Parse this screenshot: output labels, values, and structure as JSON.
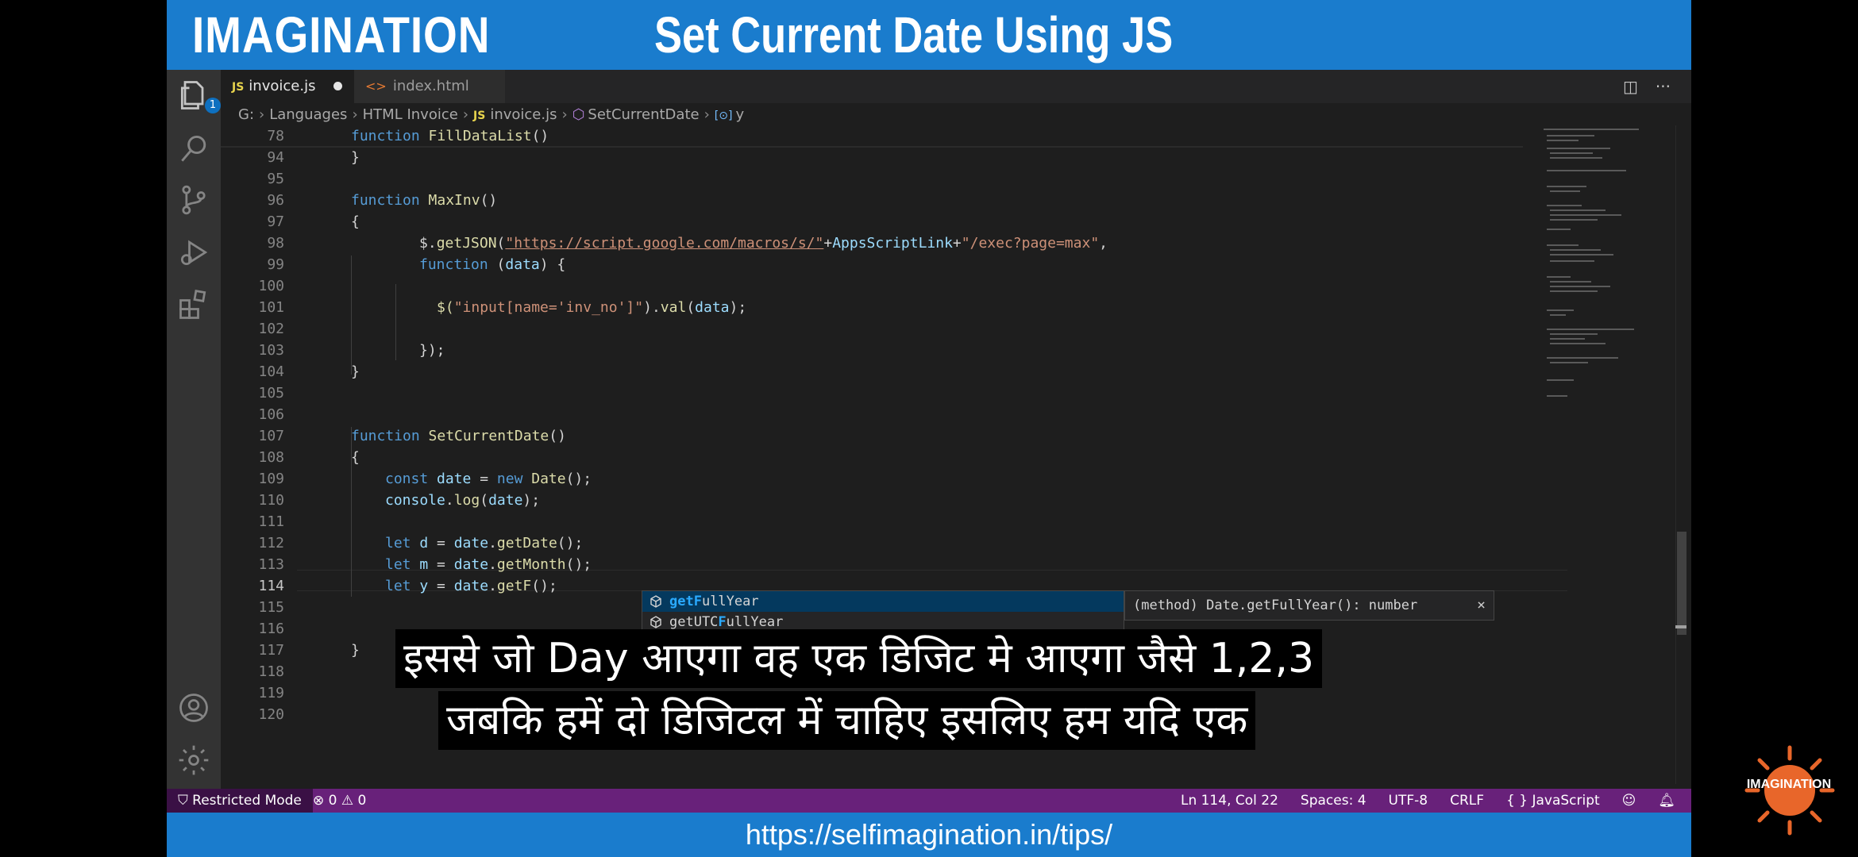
{
  "banner": {
    "brand": "IMAGINATION",
    "title": "Set Current Date Using JS"
  },
  "activity_bar": {
    "explorer_badge": "1"
  },
  "tabs": [
    {
      "lang": "JS",
      "label": "invoice.js"
    },
    {
      "lang": "<>",
      "label": "index.html"
    }
  ],
  "tab_actions": {
    "split": "◫",
    "more": "···"
  },
  "breadcrumb": [
    "G:",
    "Languages",
    "HTML Invoice",
    "invoice.js",
    "SetCurrentDate",
    "y"
  ],
  "breadcrumb_tags": {
    "js": "JS",
    "var": "[⊙]"
  },
  "editor": {
    "line_numbers": [
      "78",
      "94",
      "95",
      "96",
      "97",
      "98",
      "99",
      "100",
      "101",
      "102",
      "103",
      "104",
      "105",
      "106",
      "107",
      "108",
      "109",
      "110",
      "111",
      "112",
      "113",
      "114",
      "115",
      "116",
      "117",
      "118",
      "119",
      "120"
    ],
    "code": {
      "l78": {
        "kw": "function",
        "name": "FillDataList",
        "rest": "()"
      },
      "l94": "}",
      "l96": {
        "kw": "function",
        "name": "MaxInv",
        "rest": "()"
      },
      "l97": "{",
      "l98": {
        "a": "$.",
        "fn": "getJSON",
        "b": "(",
        "url": "\"https://script.google.com/macros/s/\"",
        "c": "+",
        "prm": "AppsScriptLink",
        "d": "+",
        "str": "\"/exec?page=max\"",
        "e": ","
      },
      "l99": {
        "kw": "function",
        "a": " (",
        "prm": "data",
        "b": ") {"
      },
      "l101": {
        "a": "$(",
        "str": "\"input[name='inv_no']\"",
        "b": ").",
        "fn": "val",
        "c": "(",
        "prm": "data",
        "d": ");"
      },
      "l103": "});",
      "l104": "}",
      "l107": {
        "kw": "function",
        "name": "SetCurrentDate",
        "rest": "()"
      },
      "l108": "{",
      "l109": {
        "kw": "const",
        "prm": " date",
        "a": " = ",
        "kw2": "new",
        "fn": " Date",
        "b": "();"
      },
      "l110": {
        "prm": "console",
        "a": ".",
        "fn": "log",
        "b": "(",
        "prm2": "date",
        "c": ");"
      },
      "l112": {
        "kw": "let",
        "prm": " d",
        "a": " = ",
        "prm2": "date",
        "b": ".",
        "fn": "getDate",
        "c": "();"
      },
      "l113": {
        "kw": "let",
        "prm": " m",
        "a": " = ",
        "prm2": "date",
        "b": ".",
        "fn": "getMonth",
        "c": "();"
      },
      "l114": {
        "kw": "let",
        "prm": " y",
        "a": " = ",
        "prm2": "date",
        "b": ".",
        "fn": "getF",
        "c": "();"
      },
      "l117": "}"
    }
  },
  "suggest": {
    "items": [
      {
        "match": "getF",
        "rest": "ullYear"
      },
      {
        "pre": "getUTC",
        "match": "F",
        "rest": "ullYear"
      }
    ],
    "detail": "(method) Date.getFullYear(): number",
    "close": "×"
  },
  "subtitles": {
    "line1": "इससे जो Day आएगा वह एक डिजिट मे आएगा जैसे 1,2,3",
    "line2": "जबकि हमें दो डिजिटल में चाहिए इसलिए हम यदि एक"
  },
  "status_bar": {
    "restricted": "Restricted Mode",
    "problems": "⊗ 0 ⚠ 0",
    "position": "Ln 114, Col 22",
    "spaces": "Spaces: 4",
    "encoding": "UTF-8",
    "eol": "CRLF",
    "language": "{ } JavaScript"
  },
  "footer": {
    "url": "https://selfimagination.in/tips/"
  },
  "watermark": {
    "text": "IMAGINATION"
  },
  "colors": {
    "banner": "#1a7ccd",
    "statusbar": "#68217a",
    "keyword": "#569cd6",
    "function": "#dcdcaa",
    "string": "#ce9178",
    "param": "#9cdcfe",
    "editor_bg": "#1e1e1e"
  }
}
